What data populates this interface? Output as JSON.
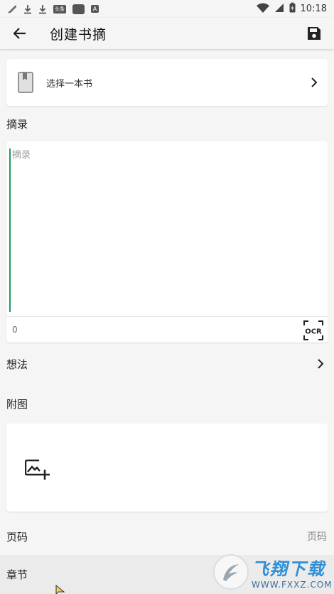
{
  "status_bar": {
    "time": "10:18",
    "news_tag": "头条",
    "a_tag": "A"
  },
  "app_bar": {
    "title": "创建书摘",
    "back_icon": "arrow-left-icon",
    "save_icon": "floppy-disk-icon"
  },
  "book_select": {
    "label": "选择一本书"
  },
  "excerpt": {
    "section_label": "摘录",
    "placeholder": "摘录",
    "char_count": "0",
    "ocr_label": "OCR"
  },
  "thoughts": {
    "label": "想法"
  },
  "attachment": {
    "label": "附图"
  },
  "page": {
    "label": "页码",
    "placeholder": "页码"
  },
  "chapter": {
    "label": "章节"
  },
  "watermark": {
    "title": "飞翔下载",
    "subtitle": "WWW.FXXZ.COM"
  },
  "colors": {
    "background": "#f5f5f5",
    "card": "#ffffff",
    "cursor_accent": "#1e9c5a",
    "watermark_blue": "#2d8fd6"
  }
}
